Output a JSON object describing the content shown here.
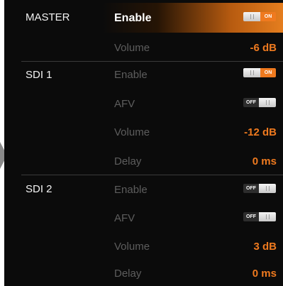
{
  "sections": [
    {
      "label": "MASTER",
      "rows": [
        {
          "label": "Enable",
          "toggle": "ON"
        },
        {
          "label": "Volume",
          "value": "-6 dB"
        }
      ]
    },
    {
      "label": "SDI 1",
      "rows": [
        {
          "label": "Enable",
          "toggle": "ON"
        },
        {
          "label": "AFV",
          "toggle": "OFF"
        },
        {
          "label": "Volume",
          "value": "-12 dB"
        },
        {
          "label": "Delay",
          "value": "0 ms"
        }
      ]
    },
    {
      "label": "SDI 2",
      "rows": [
        {
          "label": "Enable",
          "toggle": "OFF"
        },
        {
          "label": "AFV",
          "toggle": "OFF"
        },
        {
          "label": "Volume",
          "value": "3 dB"
        },
        {
          "label": "Delay",
          "value": "0 ms"
        }
      ]
    }
  ],
  "colors": {
    "accent": "#ef7a1f",
    "background": "#0b0b0b",
    "inactive_label": "#5d5d5d"
  }
}
